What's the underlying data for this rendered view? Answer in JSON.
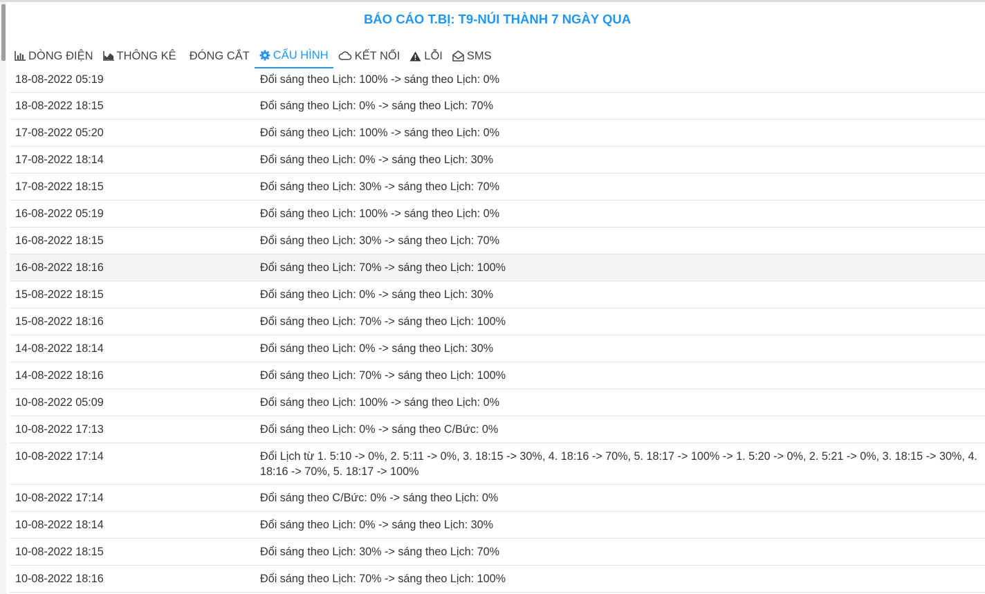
{
  "report": {
    "title": "BÁO CÁO T.BỊ: T9-NÚI THÀNH 7 NGÀY QUA"
  },
  "tabs": [
    {
      "label": "DÒNG ĐIỆN",
      "icon": "bar-chart-icon"
    },
    {
      "label": "THÔNG KÊ",
      "icon": "area-chart-icon"
    },
    {
      "label": "ĐÓNG CẮT",
      "icon": ""
    },
    {
      "label": "CẤU HÌNH",
      "icon": "gear-icon",
      "active": true
    },
    {
      "label": "KẾT NỐI",
      "icon": "cloud-icon"
    },
    {
      "label": "LỖI",
      "icon": "warning-icon"
    },
    {
      "label": "SMS",
      "icon": "envelope-open-icon"
    }
  ],
  "colors": {
    "accent": "#2196f3",
    "text": "#333333",
    "row_hover": "#f4f4f4",
    "divider": "#e3e3e3"
  },
  "rows": [
    {
      "time": "18-08-2022 05:19",
      "event": "Đổi sáng theo Lịch: 100% -> sáng theo Lịch: 0%"
    },
    {
      "time": "18-08-2022 18:15",
      "event": "Đổi sáng theo Lịch: 0% -> sáng theo Lịch: 70%"
    },
    {
      "time": "17-08-2022 05:20",
      "event": "Đổi sáng theo Lịch: 100% -> sáng theo Lịch: 0%"
    },
    {
      "time": "17-08-2022 18:14",
      "event": "Đổi sáng theo Lịch: 0% -> sáng theo Lịch: 30%"
    },
    {
      "time": "17-08-2022 18:15",
      "event": "Đổi sáng theo Lịch: 30% -> sáng theo Lịch: 70%"
    },
    {
      "time": "16-08-2022 05:19",
      "event": "Đổi sáng theo Lịch: 100% -> sáng theo Lịch: 0%"
    },
    {
      "time": "16-08-2022 18:15",
      "event": "Đổi sáng theo Lịch: 30% -> sáng theo Lịch: 70%"
    },
    {
      "time": "16-08-2022 18:16",
      "event": "Đổi sáng theo Lịch: 70% -> sáng theo Lịch: 100%"
    },
    {
      "time": "15-08-2022 18:15",
      "event": "Đổi sáng theo Lịch: 0% -> sáng theo Lịch: 30%"
    },
    {
      "time": "15-08-2022 18:16",
      "event": "Đổi sáng theo Lịch: 70% -> sáng theo Lịch: 100%"
    },
    {
      "time": "14-08-2022 18:14",
      "event": "Đổi sáng theo Lịch: 0% -> sáng theo Lịch: 30%"
    },
    {
      "time": "14-08-2022 18:16",
      "event": "Đổi sáng theo Lịch: 70% -> sáng theo Lịch: 100%"
    },
    {
      "time": "10-08-2022 05:09",
      "event": "Đổi sáng theo Lịch: 100% -> sáng theo Lịch: 0%"
    },
    {
      "time": "10-08-2022 17:13",
      "event": "Đổi sáng theo Lịch: 0% -> sáng theo C/Bức: 0%"
    },
    {
      "time": "10-08-2022 17:14",
      "event": "Đổi Lịch từ 1. 5:10 -> 0%, 2. 5:11 -> 0%, 3. 18:15 -> 30%, 4. 18:16 -> 70%, 5. 18:17 -> 100% -> 1. 5:20 -> 0%, 2. 5:21 -> 0%, 3. 18:15 -> 30%, 4. 18:16 -> 70%, 5. 18:17 -> 100%"
    },
    {
      "time": "10-08-2022 17:14",
      "event": "Đổi sáng theo C/Bức: 0% -> sáng theo Lịch: 0%"
    },
    {
      "time": "10-08-2022 18:14",
      "event": "Đổi sáng theo Lịch: 0% -> sáng theo Lịch: 30%"
    },
    {
      "time": "10-08-2022 18:15",
      "event": "Đổi sáng theo Lịch: 30% -> sáng theo Lịch: 70%"
    },
    {
      "time": "10-08-2022 18:16",
      "event": "Đổi sáng theo Lịch: 70% -> sáng theo Lịch: 100%"
    }
  ]
}
